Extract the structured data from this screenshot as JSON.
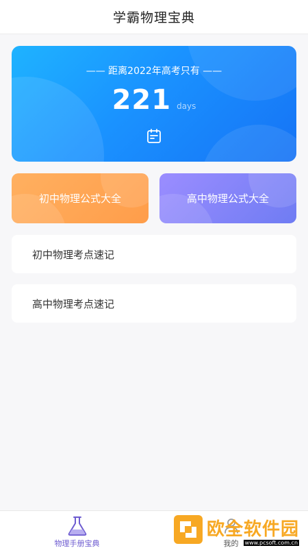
{
  "header": {
    "title": "学霸物理宝典"
  },
  "countdown": {
    "line": "—— 距离2022年高考只有 ——",
    "number": "221",
    "unit": "days",
    "icon": "calendar-icon"
  },
  "cards": [
    {
      "label": "初中物理公式大全",
      "color": "#ffa552"
    },
    {
      "label": "高中物理公式大全",
      "color": "#7f84f6"
    }
  ],
  "list": [
    {
      "label": "初中物理考点速记"
    },
    {
      "label": "高中物理考点速记"
    }
  ],
  "tabbar": {
    "tabs": [
      {
        "label": "物理手册宝典",
        "icon": "flask-icon",
        "active": true
      },
      {
        "label": "我的",
        "icon": "user-icon",
        "active": false
      }
    ]
  },
  "watermark": {
    "text": "欧全软件园",
    "url": "www.pcsoft.com.cn"
  },
  "colors": {
    "accent": "#6d5bd0",
    "blue": "#1a92ff",
    "orange": "#ffa552",
    "purple": "#7f84f6"
  }
}
